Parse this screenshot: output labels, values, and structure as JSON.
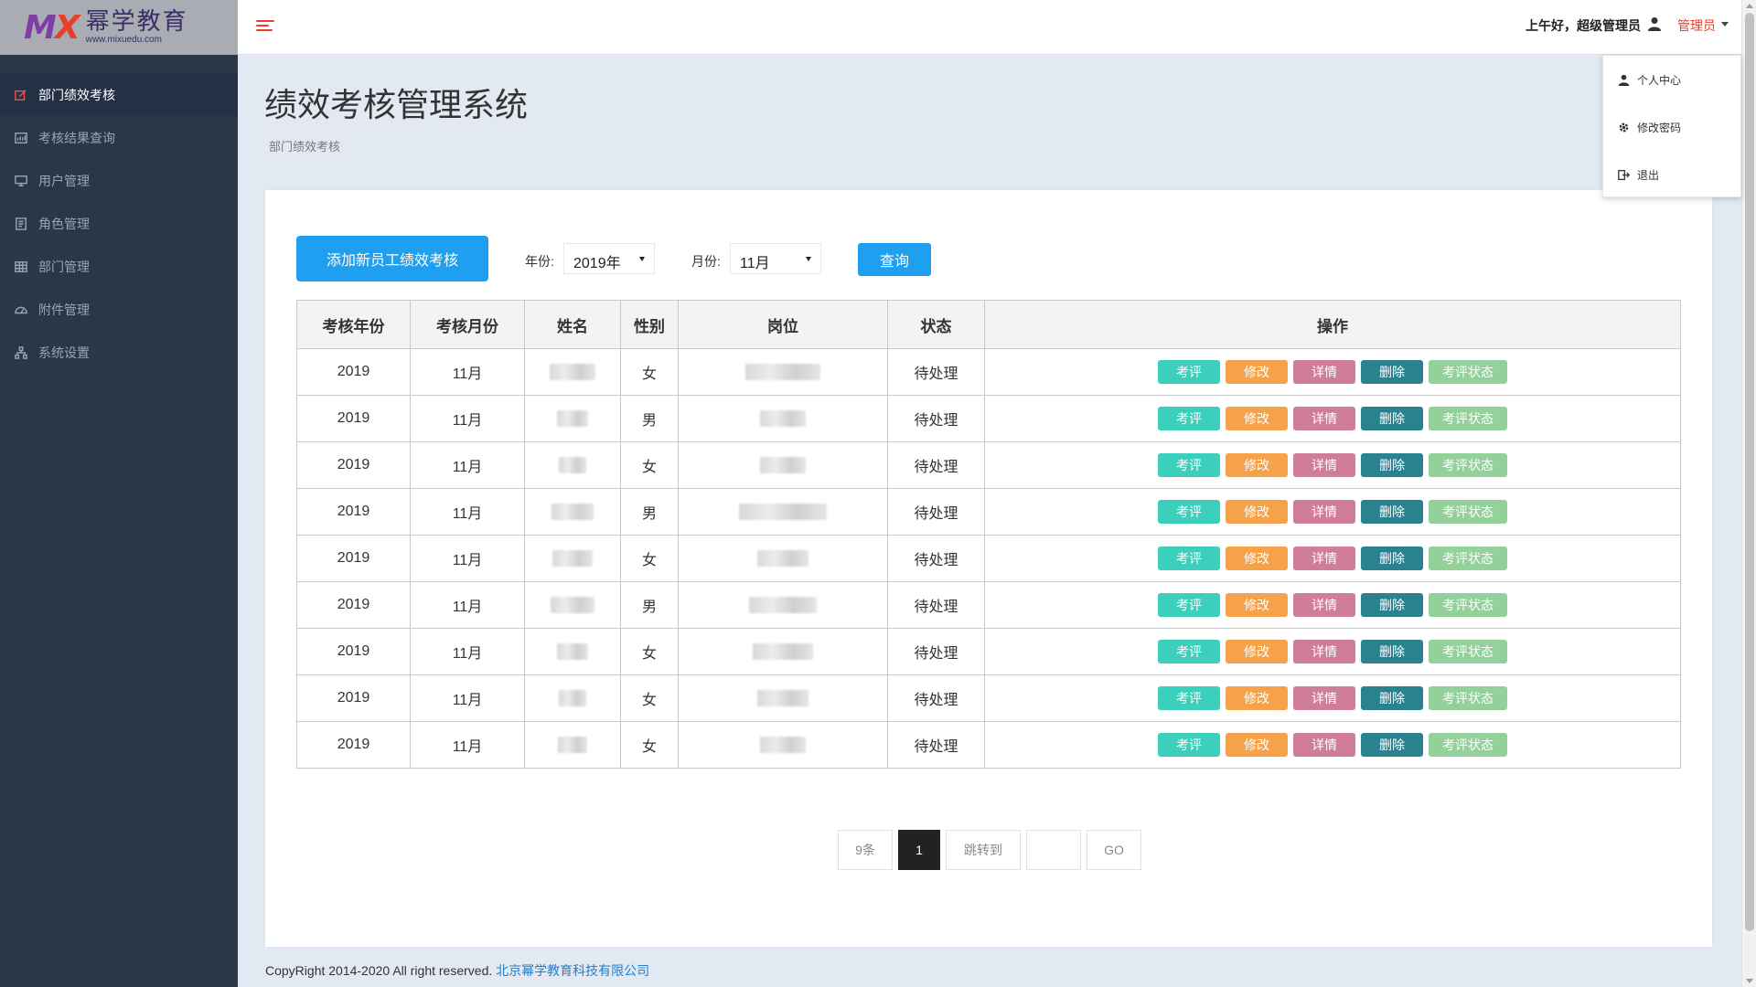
{
  "logo": {
    "mark_left": "M",
    "mark_right": "X",
    "brand_cn": "幂学教育",
    "url": "www.mixuedu.com"
  },
  "sidebar": {
    "items": [
      {
        "label": "部门绩效考核",
        "icon": "edit-icon",
        "active": true
      },
      {
        "label": "考核结果查询",
        "icon": "bar-chart-icon",
        "active": false
      },
      {
        "label": "用户管理",
        "icon": "monitor-icon",
        "active": false
      },
      {
        "label": "角色管理",
        "icon": "role-icon",
        "active": false
      },
      {
        "label": "部门管理",
        "icon": "grid-icon",
        "active": false
      },
      {
        "label": "附件管理",
        "icon": "dashboard-icon",
        "active": false
      },
      {
        "label": "系统设置",
        "icon": "sitemap-icon",
        "active": false
      }
    ]
  },
  "header": {
    "greeting": "上午好，超级管理员",
    "user_menu": "管理员"
  },
  "dropdown": {
    "items": [
      {
        "label": "个人中心",
        "icon": "user-icon"
      },
      {
        "label": "修改密码",
        "icon": "gear-icon"
      },
      {
        "label": "退出",
        "icon": "logout-icon"
      }
    ]
  },
  "main": {
    "title": "绩效考核管理系统",
    "breadcrumb": "部门绩效考核",
    "add_button": "添加新员工绩效考核",
    "year_label": "年份:",
    "year_value": "2019年",
    "month_label": "月份:",
    "month_value": "11月",
    "query_button": "查询"
  },
  "table": {
    "headers": [
      "考核年份",
      "考核月份",
      "姓名",
      "性别",
      "岗位",
      "状态",
      "操作"
    ],
    "rows": [
      {
        "year": "2019",
        "month": "11月",
        "gender": "女",
        "status": "待处理"
      },
      {
        "year": "2019",
        "month": "11月",
        "gender": "男",
        "status": "待处理"
      },
      {
        "year": "2019",
        "month": "11月",
        "gender": "女",
        "status": "待处理"
      },
      {
        "year": "2019",
        "month": "11月",
        "gender": "男",
        "status": "待处理"
      },
      {
        "year": "2019",
        "month": "11月",
        "gender": "女",
        "status": "待处理"
      },
      {
        "year": "2019",
        "month": "11月",
        "gender": "男",
        "status": "待处理"
      },
      {
        "year": "2019",
        "month": "11月",
        "gender": "女",
        "status": "待处理"
      },
      {
        "year": "2019",
        "month": "11月",
        "gender": "女",
        "status": "待处理"
      },
      {
        "year": "2019",
        "month": "11月",
        "gender": "女",
        "status": "待处理"
      }
    ],
    "actions": {
      "evaluate": "考评",
      "edit": "修改",
      "detail": "详情",
      "delete": "删除",
      "status": "考评状态"
    }
  },
  "pagination": {
    "count": "9条",
    "current": "1",
    "jump_label": "跳转到",
    "go": "GO"
  },
  "footer": {
    "copyright": "CopyRight 2014-2020 All right reserved.",
    "company": "北京幂学教育科技有限公司"
  },
  "colors": {
    "accent": "#1f9ff0",
    "sidebar_bg": "#2b3647",
    "status_pending": "#e8302f",
    "evaluate": "#3ccfbb",
    "edit": "#f6a24b",
    "detail": "#cf7d9a",
    "delete": "#2a8291",
    "status_btn": "#93d09a"
  }
}
